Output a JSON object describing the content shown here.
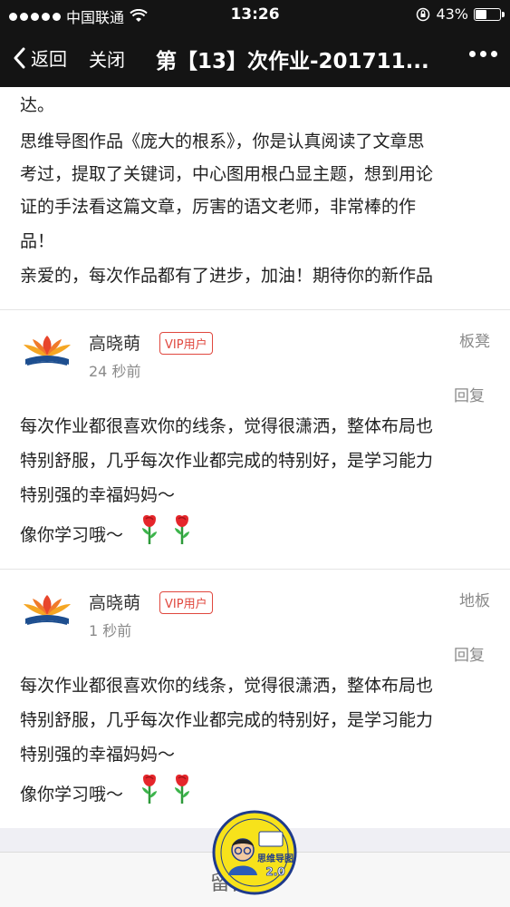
{
  "status_bar": {
    "carrier": "中国联通",
    "time": "13:26",
    "battery_text": "43%",
    "battery_level": 0.43
  },
  "nav": {
    "back_label": "返回",
    "close_label": "关闭",
    "title": "第【13】次作业-201711..."
  },
  "post": {
    "lines": [
      "达。",
      "思维导图作品《庞大的根系》，你是认真阅读了文章思",
      "考过，提取了关键词，中心图用根凸显主题，想到用论",
      "证的手法看这篇文章，厉害的语文老师，非常棒的作",
      "品！",
      "亲爱的，每次作品都有了进步，加油！期待你的新作品"
    ]
  },
  "comments": [
    {
      "author": "高晓萌",
      "vip": "VIP用户",
      "time": "24 秒前",
      "floor": "板凳",
      "reply": "回复",
      "lines": [
        "每次作业都很喜欢你的线条，觉得很潇洒，整体布局也",
        "特别舒服，几乎每次作业都完成的特别好，是学习能力",
        "特别强的幸福妈妈～",
        "像你学习哦～"
      ]
    },
    {
      "author": "高晓萌",
      "vip": "VIP用户",
      "time": "1 秒前",
      "floor": "地板",
      "reply": "回复",
      "lines": [
        "每次作业都很喜欢你的线条，觉得很潇洒，整体布局也",
        "特别舒服，几乎每次作业都完成的特别好，是学习能力",
        "特别强的幸福妈妈～",
        "像你学习哦～"
      ]
    }
  ],
  "bottom": {
    "label": "留言"
  },
  "badge": {
    "text": "思维导图",
    "version": "2.0"
  },
  "colors": {
    "bar_bg": "#141414",
    "vip_red": "#e0473e",
    "meta_gray": "#8a8a8a"
  }
}
